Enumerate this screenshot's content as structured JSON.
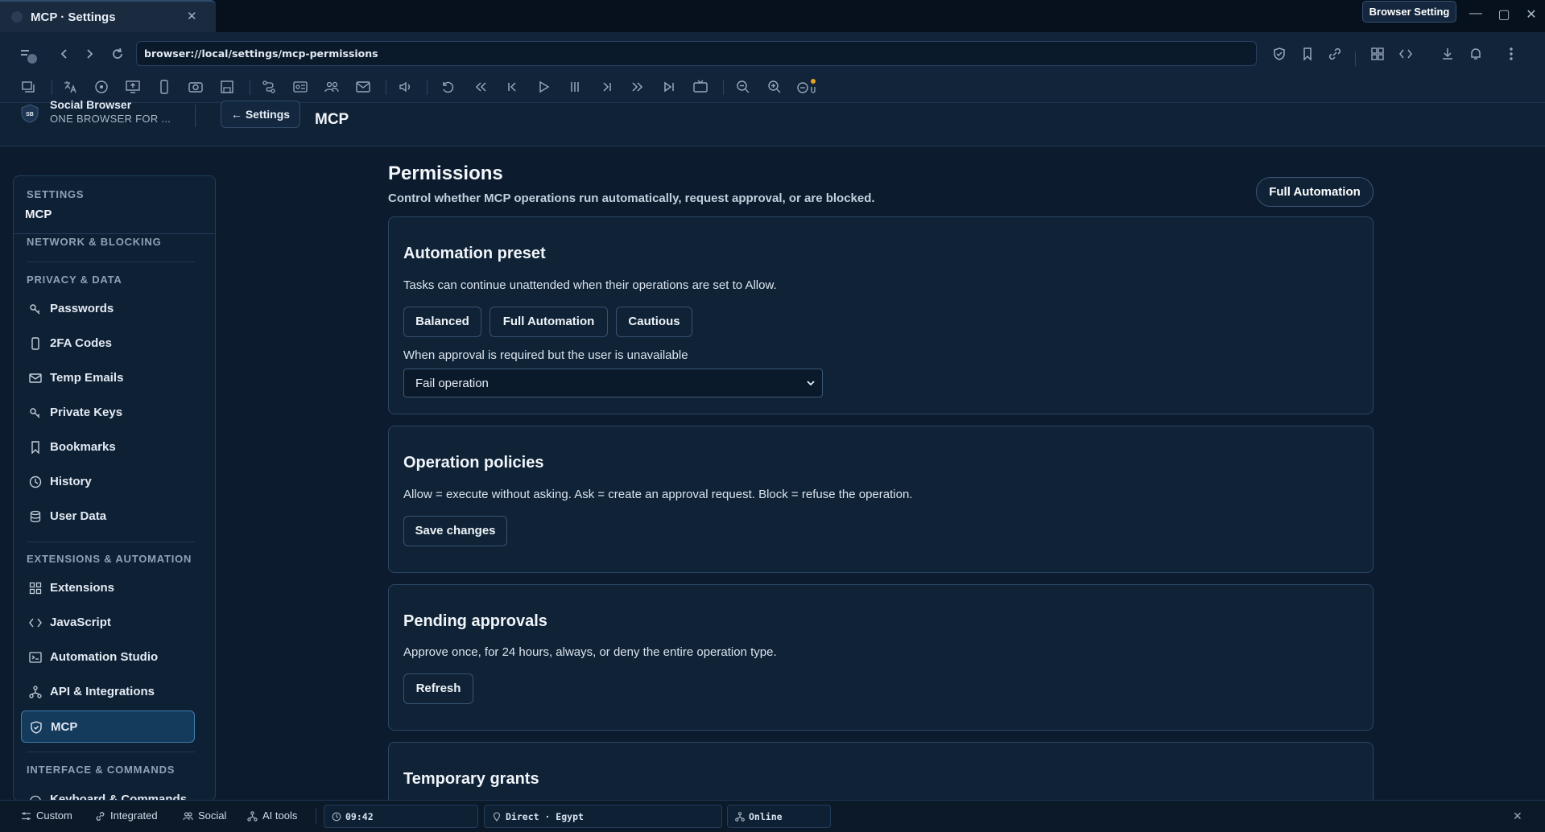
{
  "window": {
    "tab_title": "MCP · Settings",
    "browser_setting_label": "Browser Setting"
  },
  "address_bar": {
    "url": "browser://local/settings/mcp-permissions"
  },
  "header": {
    "brand_name": "Social Browser",
    "brand_tagline": "ONE BROWSER FOR ...",
    "logo_text": "SB",
    "back_label": "← Settings",
    "page_title": "MCP"
  },
  "sidebar": {
    "section_label": "SETTINGS",
    "section_value": "MCP",
    "group_network": "NETWORK & BLOCKING",
    "group_privacy": "PRIVACY & DATA",
    "privacy_items": [
      "Passwords",
      "2FA Codes",
      "Temp Emails",
      "Private Keys",
      "Bookmarks",
      "History",
      "User Data"
    ],
    "group_extensions": "EXTENSIONS & AUTOMATION",
    "extension_items": [
      "Extensions",
      "JavaScript",
      "Automation Studio",
      "API & Integrations",
      "MCP"
    ],
    "group_interface": "INTERFACE & COMMANDS",
    "interface_items": [
      "Keyboard & Commands"
    ]
  },
  "main": {
    "title": "Permissions",
    "subtitle": "Control whether MCP operations run automatically, request approval, or are blocked.",
    "preset_badge": "Full Automation",
    "automation_card": {
      "title": "Automation preset",
      "description": "Tasks can continue unattended when their operations are set to Allow.",
      "presets": [
        "Balanced",
        "Full Automation",
        "Cautious"
      ],
      "unavailable_label": "When approval is required but the user is unavailable",
      "unavailable_value": "Fail operation"
    },
    "policies_card": {
      "title": "Operation policies",
      "description": "Allow = execute without asking. Ask = create an approval request. Block = refuse the operation.",
      "save_label": "Save changes"
    },
    "pending_card": {
      "title": "Pending approvals",
      "description": "Approve once, for 24 hours, always, or deny the entire operation type.",
      "refresh_label": "Refresh"
    },
    "grants_card": {
      "title": "Temporary grants"
    }
  },
  "statusbar": {
    "items": [
      "Custom",
      "Integrated",
      "Social",
      "AI tools"
    ],
    "time": "09:42",
    "location": "Direct · Egypt",
    "connection": "Online"
  },
  "icons": [
    "tab-favicon-icon",
    "close-icon",
    "minimize-icon",
    "maximize-icon",
    "back-icon",
    "forward-icon",
    "reload-icon",
    "shield-icon",
    "bookmark-icon",
    "link-icon",
    "extensions-icon",
    "code-icon",
    "download-icon",
    "bell-icon",
    "more-vertical-icon"
  ]
}
